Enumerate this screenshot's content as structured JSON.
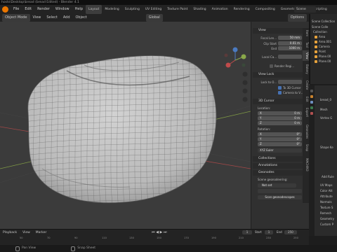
{
  "window": {
    "title": "hosts\\Desktop\\bread (bread Edited) - Blender 4.1"
  },
  "menubar": {
    "menus": [
      "File",
      "Edit",
      "Render",
      "Window",
      "Help"
    ],
    "workspaces": [
      "Layout",
      "Modeling",
      "Sculpting",
      "UV Editing",
      "Texture Paint",
      "Shading",
      "Animation",
      "Rendering",
      "Compositing",
      "Geometry Nodes",
      "Scripting"
    ],
    "scene_label": "Scene"
  },
  "viewport_header": {
    "mode": "Object Mode",
    "menus": [
      "View",
      "Select",
      "Add",
      "Object"
    ],
    "transform": "Global",
    "options_label": "Options"
  },
  "npanel": {
    "view_section": "View",
    "focal_length": {
      "label": "Focal Len...",
      "value": "50 mm"
    },
    "clip_start": {
      "label": "Clip Start",
      "value": "0.01 m"
    },
    "clip_end": {
      "label": "End",
      "value": "1000 m"
    },
    "local_camera": {
      "label": "Local Ca..."
    },
    "render_region": "Render Regi...",
    "view_lock": "View Lock",
    "lock_to_object": "Lock to O...",
    "lock_to_3d_cursor": "To 3D Cursor",
    "camera_to_view": "Camera to V...",
    "cursor_section": "3D Cursor",
    "location_label": "Location:",
    "loc": [
      {
        "axis": "X",
        "value": "0 m"
      },
      {
        "axis": "Y",
        "value": "0 m"
      },
      {
        "axis": "Z",
        "value": "0 m"
      }
    ],
    "rotation_label": "Rotation:",
    "rot": [
      {
        "axis": "X",
        "value": "0°"
      },
      {
        "axis": "Y",
        "value": "0°"
      },
      {
        "axis": "Z",
        "value": "0°"
      }
    ],
    "rotation_mode": "XYZ Euler",
    "collections": "Collections",
    "annotations": "Annotations",
    "geonodes_section": "Geonodes",
    "scene_geonodes_label": "Scene geonodeering:",
    "not_set": "Not set",
    "geo_button": "Scan geonodescopes",
    "tabs": [
      "Item",
      "Tool",
      "View",
      "Bakery",
      "Create",
      "Edit",
      "Export",
      "Geonodes",
      "Snap",
      "MACHIN3"
    ]
  },
  "outliner": {
    "header": "Scene Collection",
    "items": [
      {
        "name": "Scene Colle",
        "color": "#e0e0e0"
      },
      {
        "name": "Collection",
        "color": "#e0e0e0"
      },
      {
        "name": "Area",
        "color": "#e8a33c"
      },
      {
        "name": "Area.001",
        "color": "#e8a33c"
      },
      {
        "name": "Camera",
        "color": "#e8a33c"
      },
      {
        "name": "Point",
        "color": "#e8a33c"
      },
      {
        "name": "Plane.00",
        "color": "#e8a33c"
      },
      {
        "name": "Plane.00",
        "color": "#e8a33c"
      }
    ]
  },
  "properties": {
    "object_name": "bread_0",
    "items": [
      "Mesh",
      "Vertex G",
      "Shape Ke",
      "UV Maps",
      "Color Att",
      "Attribute",
      "Normals",
      "Texture S",
      "Remesh",
      "Geometry",
      "Custom P"
    ],
    "add_rule": "Add Rule"
  },
  "timeline": {
    "menus": [
      "Playback",
      "View",
      "Marker"
    ],
    "ticks": [
      "50",
      "70",
      "90",
      "110",
      "130",
      "150",
      "170",
      "190",
      "210",
      "230",
      "250"
    ],
    "current_frame": "1",
    "start_label": "Start",
    "start_value": "1",
    "end_label": "End",
    "end_value": "250"
  },
  "statusbar": {
    "pan_view": "Pan View",
    "snap": "Snap Sheet"
  },
  "colors": {
    "accent": "#4772b3",
    "orange": "#e8a33c",
    "axis_x": "#c04b4b",
    "axis_y": "#8aa84a",
    "axis_z": "#4b7ac0"
  }
}
